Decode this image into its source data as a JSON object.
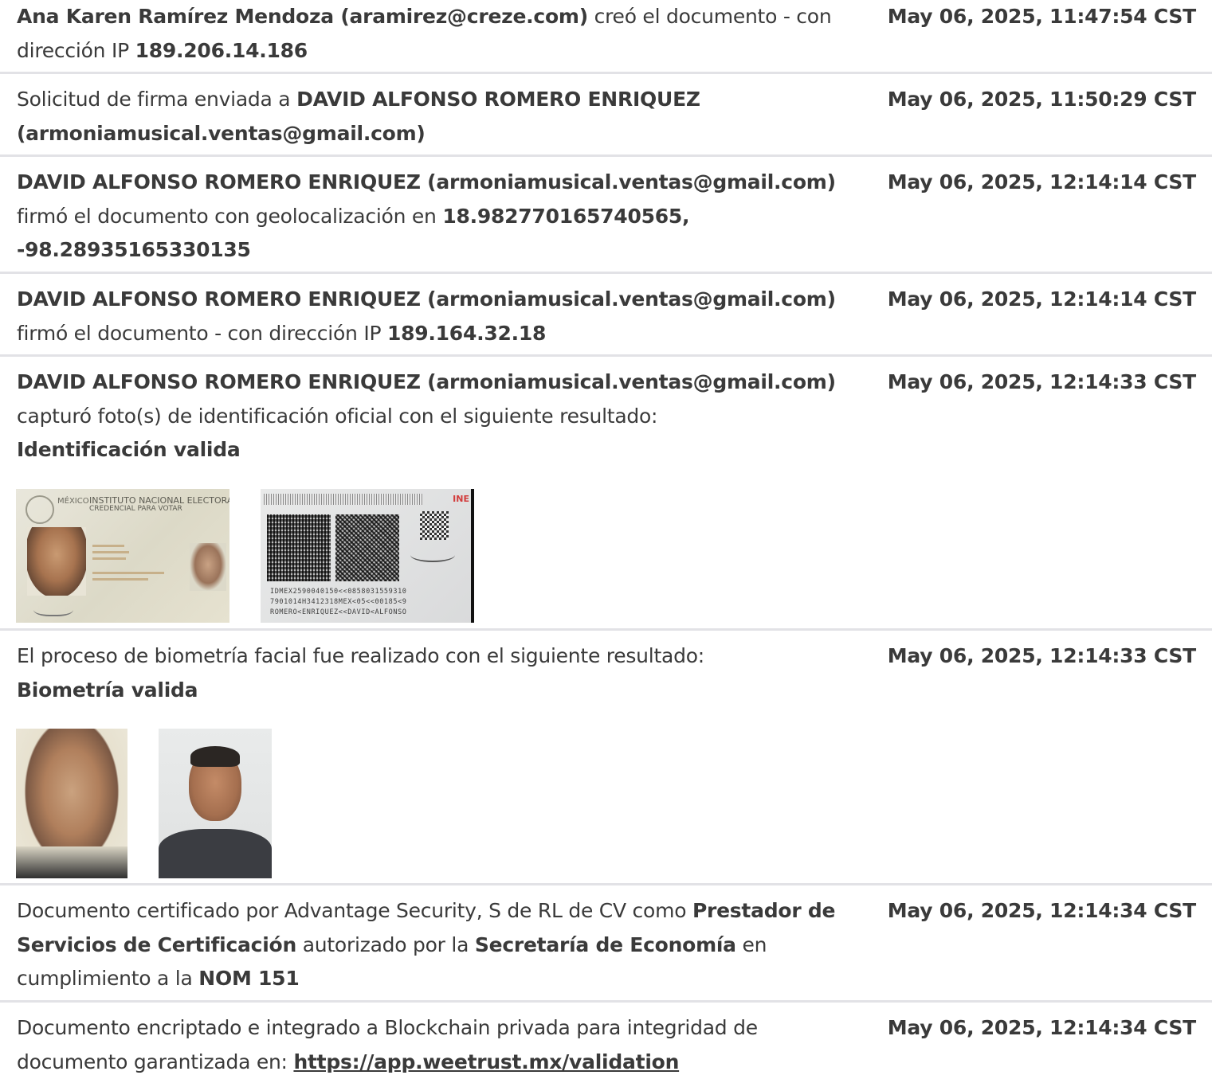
{
  "entries": [
    {
      "id": "created",
      "timestamp": "May 06, 2025, 11:47:54 CST",
      "parts": [
        {
          "b": "Ana Karen Ramírez Mendoza (aramirez@creze.com)"
        },
        {
          "t": " creó el documento - con dirección IP "
        },
        {
          "b": "189.206.14.186"
        }
      ]
    },
    {
      "id": "sent",
      "timestamp": "May 06, 2025, 11:50:29 CST",
      "parts": [
        {
          "t": "Solicitud de firma enviada a "
        },
        {
          "b": "DAVID ALFONSO ROMERO ENRIQUEZ (armoniamusical.ventas@gmail.com)"
        }
      ]
    },
    {
      "id": "signed-geo",
      "timestamp": "May 06, 2025, 12:14:14 CST",
      "parts": [
        {
          "b": "DAVID ALFONSO ROMERO ENRIQUEZ (armoniamusical.ventas@gmail.com)"
        },
        {
          "t": " firmó el documento con geolocalización en "
        },
        {
          "b": "18.982770165740565, -98.28935165330135"
        }
      ]
    },
    {
      "id": "signed-ip",
      "timestamp": "May 06, 2025, 12:14:14 CST",
      "parts": [
        {
          "b": "DAVID ALFONSO ROMERO ENRIQUEZ (armoniamusical.ventas@gmail.com)"
        },
        {
          "t": " firmó el documento - con dirección IP "
        },
        {
          "b": "189.164.32.18"
        }
      ]
    },
    {
      "id": "id-capture",
      "timestamp": "May 06, 2025, 12:14:33 CST",
      "parts": [
        {
          "b": "DAVID ALFONSO ROMERO ENRIQUEZ (armoniamusical.ventas@gmail.com)"
        },
        {
          "t": " capturó foto(s) de identificación oficial con el siguiente resultado:"
        },
        {
          "br": true
        },
        {
          "b": "Identificación valida"
        }
      ]
    },
    {
      "id": "biometry",
      "timestamp": "May 06, 2025, 12:14:33 CST",
      "parts": [
        {
          "t": "El proceso de biometría facial fue realizado con el siguiente resultado:"
        },
        {
          "br": true
        },
        {
          "b": "Biometría valida"
        }
      ]
    },
    {
      "id": "certified",
      "timestamp": "May 06, 2025, 12:14:34 CST",
      "parts": [
        {
          "t": "Documento certificado por Advantage Security, S de RL de CV como "
        },
        {
          "b": "Prestador de Servicios de Certificación"
        },
        {
          "t": " autorizado por la "
        },
        {
          "b": "Secretaría de Economía"
        },
        {
          "t": " en cumplimiento a la "
        },
        {
          "b": "NOM 151"
        }
      ]
    },
    {
      "id": "blockchain",
      "timestamp": "May 06, 2025, 12:14:34 CST",
      "parts": [
        {
          "t": "Documento encriptado e integrado a Blockchain privada para integridad de documento garantizada en: "
        },
        {
          "link": "https://app.weetrust.mx/validation"
        }
      ]
    }
  ],
  "id_card": {
    "country": "MÉXICO",
    "institute": "INSTITUTO NACIONAL ELECTORAL",
    "credential": "CREDENCIAL PARA VOTAR",
    "back_logo": "INE",
    "mrz": [
      "IDMEX2590040150<<0858031559310",
      "7901014H3412318MEX<05<<00185<9",
      "ROMERO<ENRIQUEZ<<DAVID<ALFONSO"
    ]
  }
}
